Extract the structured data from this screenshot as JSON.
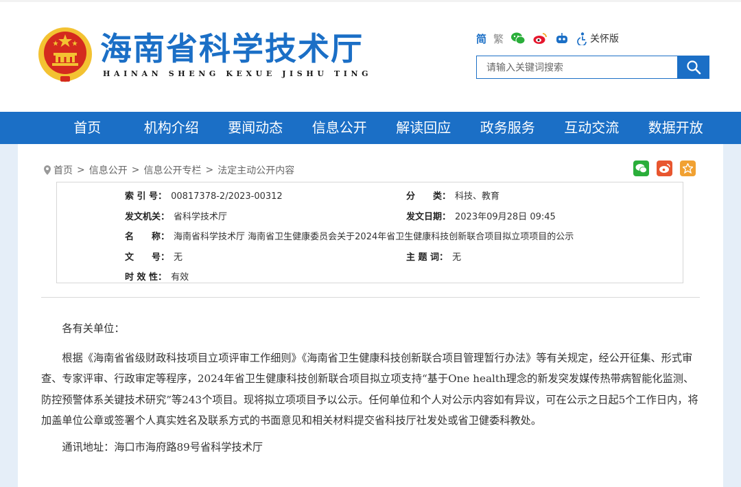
{
  "header": {
    "title": "海南省科学技术厅",
    "subtitle": "HAINAN SHENG KEXUE JISHU TING",
    "tools": {
      "simplified": "简",
      "traditional": "繁",
      "care_label": "关怀版"
    },
    "search": {
      "placeholder": "请输入关键词搜索"
    }
  },
  "nav": {
    "items": [
      "首页",
      "机构介绍",
      "要闻动态",
      "信息公开",
      "解读回应",
      "政务服务",
      "互动交流",
      "数据开放"
    ]
  },
  "breadcrumb": [
    "首页",
    "信息公开",
    "信息公开专栏",
    "法定主动公开内容"
  ],
  "meta": {
    "index_label": "索 引 号：",
    "index_value": "00817378-2/2023-00312",
    "category_label": "分　　类：",
    "category_value": "科技、教育",
    "issuer_label": "发文机关：",
    "issuer_value": "省科学技术厅",
    "date_label": "发文日期：",
    "date_value": "2023年09月28日 09:45",
    "name_label": "名　　称：",
    "name_value": "海南省科学技术厅 海南省卫生健康委员会关于2024年省卫生健康科技创新联合项目拟立项项目的公示",
    "docno_label": "文　　号：",
    "docno_value": "无",
    "topic_label": "主 题 词：",
    "topic_value": "无",
    "validity_label": "时 效 性：",
    "validity_value": "有效"
  },
  "article": {
    "greeting": "各有关单位：",
    "paragraph": "根据《海南省省级财政科技项目立项评审工作细则》《海南省卫生健康科技创新联合项目管理暂行办法》等有关规定，经公开征集、形式审查、专家评审、行政审定等程序，2024年省卫生健康科技创新联合项目拟立项支持“基于One health理念的新发突发媒传热带病智能化监测、防控预警体系关键技术研究”等243个项目。现将拟立项项目予以公示。任何单位和个人对公示内容如有异议，可在公示之日起5个工作日内，将加盖单位公章或签署个人真实姓名及联系方式的书面意见和相关材料提交省科技厅社发处或省卫健委科教处。",
    "address": "通讯地址：海口市海府路89号省科学技术厅"
  },
  "colors": {
    "brand_blue": "#1b6fc6",
    "emblem_red": "#d42a1e",
    "emblem_gold": "#f3c232",
    "wechat_green": "#2aae3a",
    "weibo_orange": "#e8562f",
    "favorite_yellow": "#f1a132"
  },
  "icons": [
    "national-emblem-icon",
    "wechat-icon",
    "weibo-icon",
    "robot-icon",
    "care-icon",
    "search-icon",
    "location-pin-icon",
    "star-icon"
  ]
}
